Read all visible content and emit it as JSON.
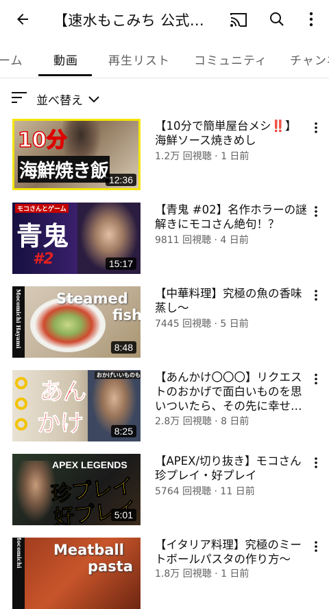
{
  "header": {
    "title": "【速水もこみち 公式チャンネル】",
    "back_icon": "back-arrow-icon",
    "cast_icon": "cast-icon",
    "search_icon": "search-icon",
    "more_icon": "more-vert-icon"
  },
  "tabs": [
    {
      "label": "ホーム",
      "visible_label": "ーム"
    },
    {
      "label": "動画",
      "active": true
    },
    {
      "label": "再生リスト"
    },
    {
      "label": "コミュニティ"
    },
    {
      "label": "チャンネル",
      "visible_label": "チャンネ"
    }
  ],
  "sort": {
    "label": "並べ替え",
    "icon": "sort-icon",
    "chevron": "chevron-down-icon"
  },
  "videos": [
    {
      "title": "【10分で簡単屋台メシ‼️】海鮮ソース焼きめし",
      "views": "1.2万 回視聴",
      "age": "1 日前",
      "meta": "1.2万 回視聴 · 1 日前",
      "duration": "12:36",
      "thumb_text": [
        "10分",
        "海鮮焼き飯"
      ]
    },
    {
      "title": "【青鬼 #02】名作ホラーの謎解きにモコさん絶句！？",
      "views": "9811 回視聴",
      "age": "4 日前",
      "meta": "9811 回視聴 · 4 日前",
      "duration": "15:17",
      "thumb_text": [
        "モコさんとゲーム",
        "青鬼",
        "#2"
      ]
    },
    {
      "title": "【中華料理】究極の魚の香味蒸し〜",
      "views": "7445 回視聴",
      "age": "5 日前",
      "meta": "7445 回視聴 · 5 日前",
      "duration": "8:48",
      "thumb_text": [
        "Steamed",
        "fish",
        "Mocomichi Hayami"
      ]
    },
    {
      "title": "【あんかけ〇〇〇】リクエストのおかげで面白いものを思いついたら、その先に幸せ…",
      "views": "2.8万 回視聴",
      "age": "8 日前",
      "meta": "2.8万 回視聴 · 8 日前",
      "duration": "8:25",
      "thumb_text": [
        "あん",
        "かけ",
        "おかげいいものも"
      ]
    },
    {
      "title": "【APEX/切り抜き】モコさん珍プレイ・好プレイ",
      "views": "5764 回視聴",
      "age": "11 日前",
      "meta": "5764 回視聴 · 11 日前",
      "duration": "5:01",
      "thumb_text": [
        "APEX LEGENDS",
        "珍プレイ",
        "好プレイ"
      ]
    },
    {
      "title": "【イタリア料理】究極のミートボールパスタの作り方〜",
      "views": "1.8万 回視聴",
      "age": "1 日前",
      "meta": "1.8万 回視聴 · 1 日前",
      "duration": "",
      "thumb_text": [
        "Meatball",
        "pasta",
        "Mocomichi"
      ]
    }
  ],
  "colors": {
    "text_primary": "#0f0f0f",
    "text_secondary": "#606060",
    "duration_bg": "#000000",
    "thumb1_border": "#f5e600",
    "thumb2_bg": "#1a1140",
    "thumb5_text": "#f7d21c"
  }
}
